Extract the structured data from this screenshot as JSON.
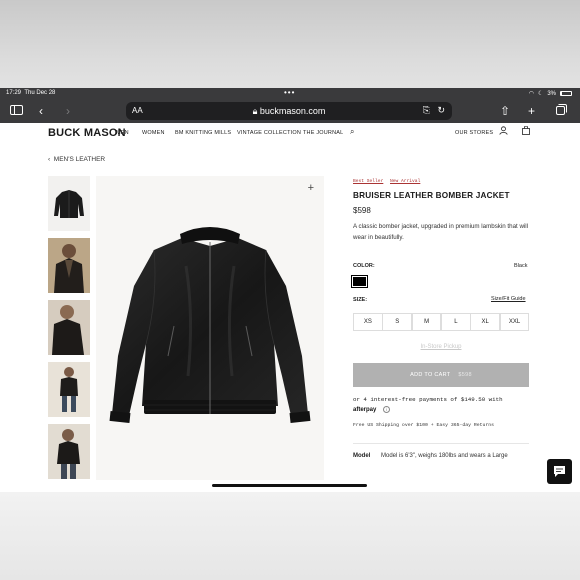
{
  "status_bar": {
    "time": "17:29",
    "date": "Thu Dec 28",
    "battery": "3%"
  },
  "browser": {
    "text_size": "AA",
    "url": "buckmason.com"
  },
  "site": {
    "logo": "BUCK MASON",
    "nav": [
      "MEN",
      "WOMEN",
      "BM KNITTING MILLS",
      "VINTAGE COLLECTION",
      "THE JOURNAL"
    ],
    "our_stores": "OUR STORES"
  },
  "breadcrumb": "MEN'S LEATHER",
  "product": {
    "badges": [
      "Best Seller",
      "New Arrival"
    ],
    "title": "BRUISER LEATHER BOMBER JACKET",
    "price": "$598",
    "description": "A classic bomber jacket, upgraded in premium lambskin that will wear in beautifully.",
    "color_label": "COLOR:",
    "color_value": "Black",
    "size_label": "SIZE:",
    "size_guide": "Size/Fit Guide",
    "sizes": [
      "XS",
      "S",
      "M",
      "L",
      "XL",
      "XXL"
    ],
    "pickup": "In-Store Pickup",
    "add_to_cart": "ADD TO CART",
    "cart_price": "$598",
    "afterpay_text": "or 4 interest-free payments of $149.50 with",
    "afterpay_logo": "afterpay",
    "shipping": "Free US Shipping over $100 + Easy 365-day Returns",
    "model_label": "Model",
    "model_text": "Model is 6'3\", weighs 180lbs and wears a Large"
  },
  "colors": {
    "toolbar": "#3a3a3c",
    "cart_button": "#b1b1b1",
    "badge": "#a33333"
  }
}
